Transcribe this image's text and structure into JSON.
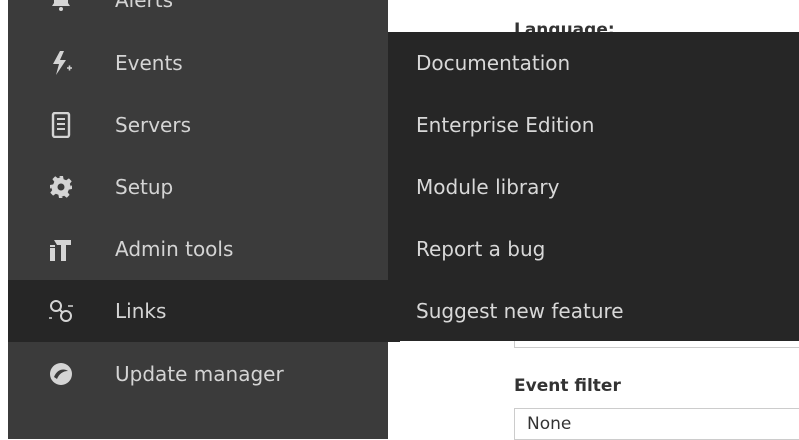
{
  "sidebar": {
    "items": [
      {
        "label": "Alerts",
        "icon": "bell-icon"
      },
      {
        "label": "Events",
        "icon": "lightning-icon"
      },
      {
        "label": "Servers",
        "icon": "server-icon"
      },
      {
        "label": "Setup",
        "icon": "gear-icon"
      },
      {
        "label": "Admin tools",
        "icon": "admin-tools-icon"
      },
      {
        "label": "Links",
        "icon": "link-icon"
      },
      {
        "label": "Update manager",
        "icon": "update-manager-icon"
      }
    ],
    "active_item": "Links"
  },
  "submenu": {
    "items": [
      {
        "label": "Documentation"
      },
      {
        "label": "Enterprise Edition"
      },
      {
        "label": "Module library"
      },
      {
        "label": "Report a bug"
      },
      {
        "label": "Suggest new feature"
      }
    ]
  },
  "main": {
    "language_label": "Language:",
    "event_filter_label": "Event filter",
    "event_filter_value": "None"
  },
  "colors": {
    "sidebar_bg": "#3b3b3b",
    "active_bg": "#262626",
    "submenu_bg": "#262626",
    "text": "#d4d4d4"
  }
}
